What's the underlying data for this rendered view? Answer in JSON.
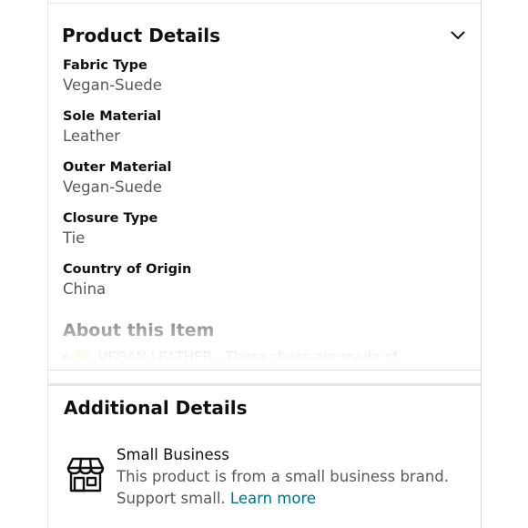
{
  "product_details": {
    "title": "Product Details",
    "items": [
      {
        "label": "Fabric Type",
        "value": "Vegan-Suede"
      },
      {
        "label": "Sole Material",
        "value": "Leather"
      },
      {
        "label": "Outer Material",
        "value": "Vegan-Suede"
      },
      {
        "label": "Closure Type",
        "value": "Tie"
      },
      {
        "label": "Country of Origin",
        "value": "China"
      }
    ]
  },
  "about": {
    "title": "About this Item",
    "first_bullet": "VEGAN LEATHER - These shoes are made of"
  },
  "additional_details": {
    "title": "Additional Details",
    "small_business": {
      "name": "Small Business",
      "description": "This product is from a small business brand. Support small.",
      "link": "Learn more"
    }
  },
  "colors": {
    "link": "#007185",
    "text": "#0f1111",
    "secondary_text": "#565959",
    "divider": "#e3e6e6"
  },
  "icons": {
    "expand": "chevron-down-icon",
    "small_business": "storefront-icon"
  }
}
